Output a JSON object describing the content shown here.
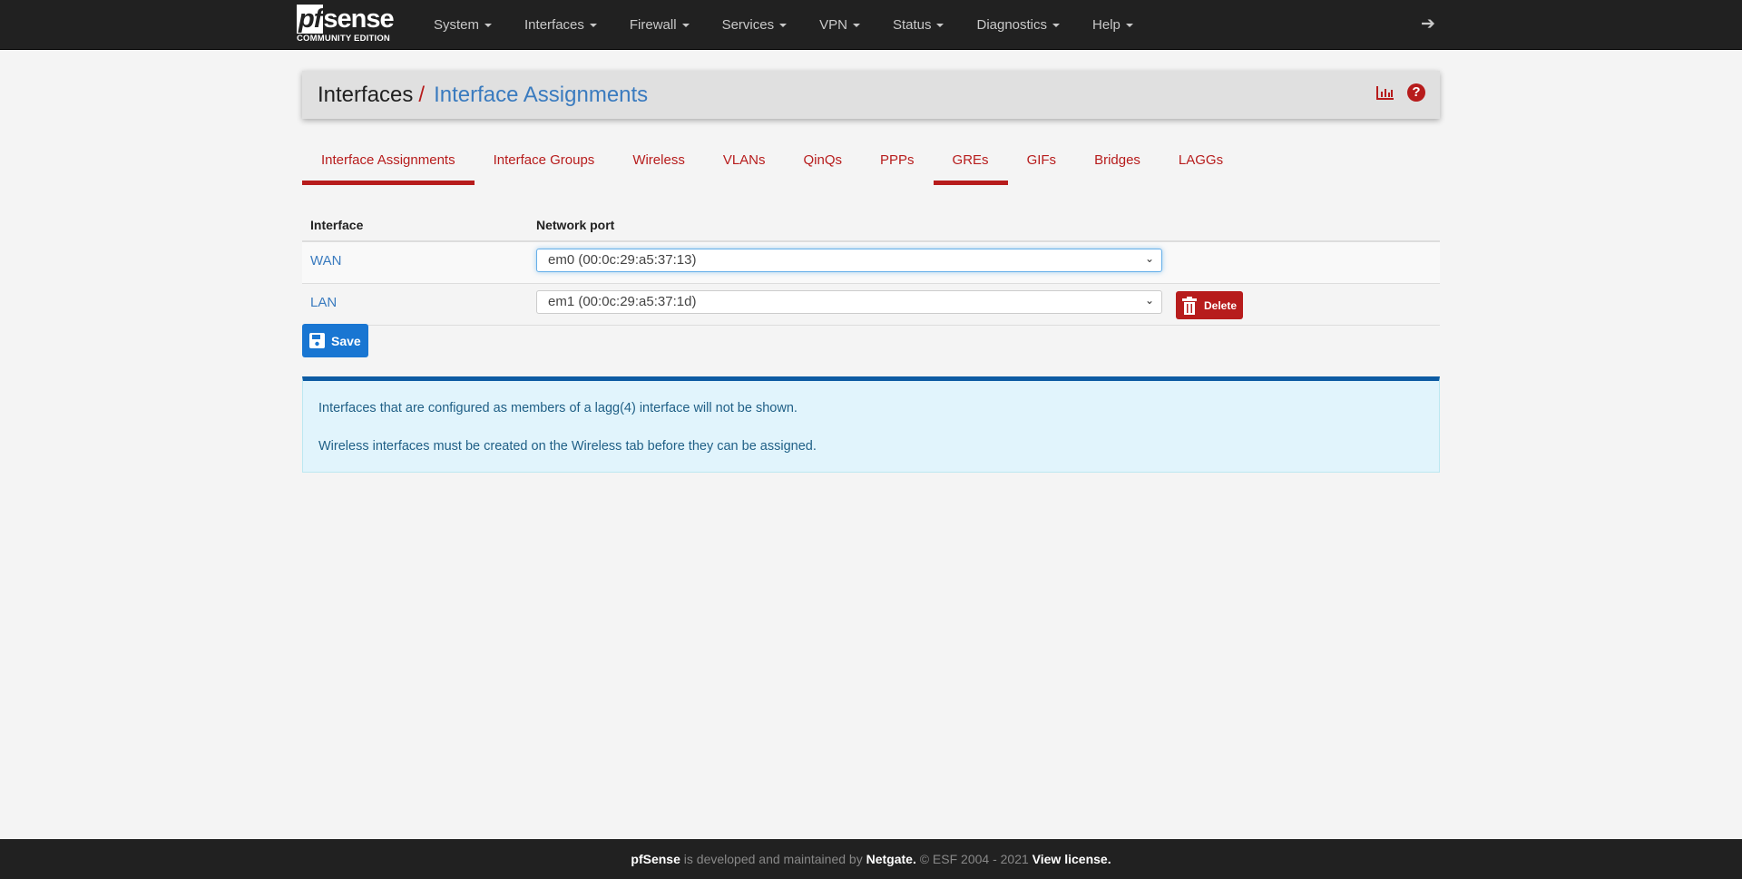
{
  "brand": {
    "name": "pfsense",
    "pf": "pf",
    "sense": "sense",
    "edition": "COMMUNITY EDITION"
  },
  "menu": [
    "System",
    "Interfaces",
    "Firewall",
    "Services",
    "VPN",
    "Status",
    "Diagnostics",
    "Help"
  ],
  "breadcrumb": {
    "parent": "Interfaces",
    "separator": "/",
    "current": "Interface Assignments"
  },
  "tabs": [
    {
      "label": "Interface Assignments",
      "active": true
    },
    {
      "label": "Interface Groups"
    },
    {
      "label": "Wireless"
    },
    {
      "label": "VLANs"
    },
    {
      "label": "QinQs"
    },
    {
      "label": "PPPs"
    },
    {
      "label": "GREs",
      "active": true
    },
    {
      "label": "GIFs"
    },
    {
      "label": "Bridges"
    },
    {
      "label": "LAGGs"
    }
  ],
  "table": {
    "headers": [
      "Interface",
      "Network port"
    ],
    "rows": [
      {
        "interface": "WAN",
        "port": "em0 (00:0c:29:a5:37:13)"
      },
      {
        "interface": "LAN",
        "port": "em1 (00:0c:29:a5:37:1d)",
        "action": "Delete"
      }
    ]
  },
  "save_label": "Save",
  "info": [
    "Interfaces that are configured as members of a lagg(4) interface will not be shown.",
    "Wireless interfaces must be created on the Wireless tab before they can be assigned."
  ],
  "footer": {
    "brand": "pfSense",
    "text1": " is developed and maintained by ",
    "company": "Netgate.",
    "text2": " © ESF 2004 - 2021 ",
    "license": "View license."
  },
  "colors": {
    "accent": "#b71c1c",
    "link": "#3a7bbf",
    "save": "#1976d2"
  }
}
